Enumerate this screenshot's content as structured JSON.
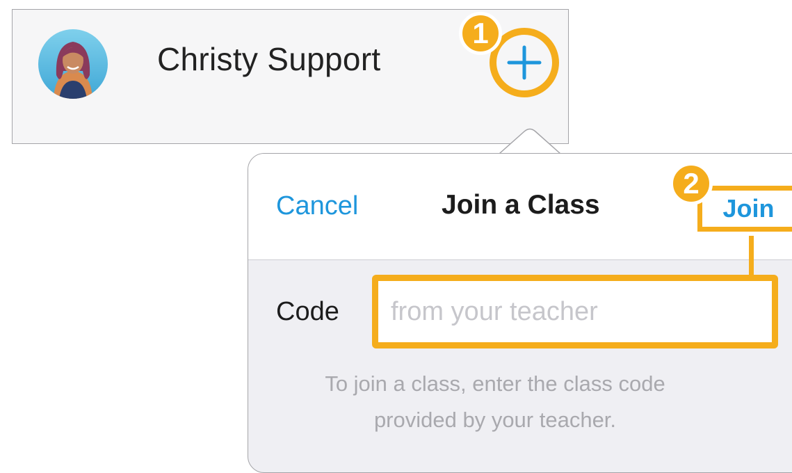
{
  "profile": {
    "name": "Christy Support",
    "avatar_icon": "user-avatar-photo",
    "add_icon": "plus-icon"
  },
  "callouts": {
    "step1": "1",
    "step2": "2"
  },
  "popover": {
    "cancel_label": "Cancel",
    "title": "Join a Class",
    "join_label": "Join",
    "code_label": "Code",
    "code_placeholder": "from your teacher",
    "code_value": "",
    "helper_line1": "To join a class, enter the class code",
    "helper_line2": "provided by your teacher."
  },
  "colors": {
    "accent_blue": "#1e96dc",
    "callout_orange": "#f5ad1c",
    "text_dark": "#1c1c1c",
    "hint_gray": "#a9a9ae",
    "popover_bg": "#efeff3"
  }
}
